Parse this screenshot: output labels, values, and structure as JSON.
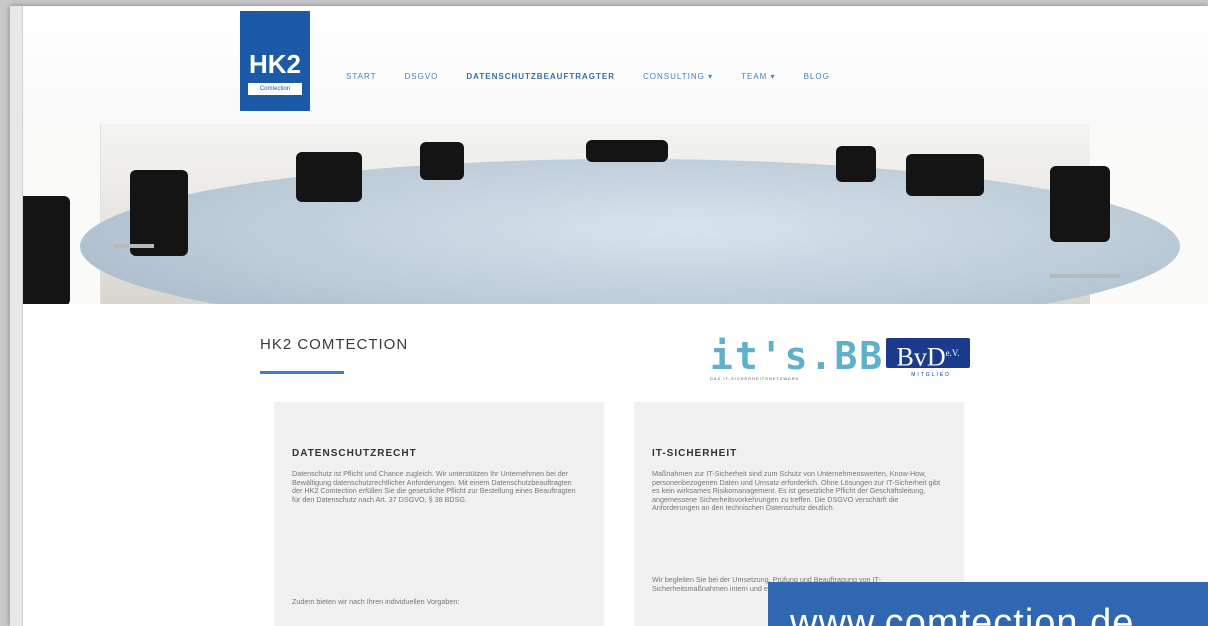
{
  "logo": {
    "text": "HK2",
    "sub": "Comtection"
  },
  "nav": [
    {
      "label": "START"
    },
    {
      "label": "DSGVO"
    },
    {
      "label": "DATENSCHUTZBEAUFTRAGTER"
    },
    {
      "label": "CONSULTING ▾"
    },
    {
      "label": "TEAM ▾"
    },
    {
      "label": "BLOG"
    }
  ],
  "section": {
    "title": "HK2 COMTECTION"
  },
  "badges": {
    "its": {
      "text": "it's.BB",
      "tag": "DAS IT-SICHERHEITSNETZWERK"
    },
    "bvd": {
      "text": "BvD",
      "sup": "e.V.",
      "sub": "MITGLIED"
    }
  },
  "cards": [
    {
      "title": "DATENSCHUTZRECHT",
      "body": "Datenschutz ist Pflicht und Chance zugleich. Wir unterstützen Ihr Unternehmen bei der Bewältigung datenschutzrechtlicher Anforderungen. Mit einem Datenschutzbeauftragten der HK2 Comtection erfüllen Sie die gesetzliche Pflicht zur Bestellung eines Beauftragten für den Datenschutz nach Art. 37 DSGVO, § 38 BDSG.",
      "body2": "Zudem bieten wir nach Ihren individuellen Vorgaben:"
    },
    {
      "title": "IT-SICHERHEIT",
      "body": "Maßnahmen zur IT-Sicherheit sind zum Schutz von Unternehmenswerten, Know-How, personenbezogenen Daten und Umsatz erforderlich. Ohne Lösungen zur IT-Sicherheit gibt es kein wirksames Risikomanagement. Es ist gesetzliche Pflicht der Geschäftsleitung, angemessene Sicherheitsvorkehrungen zu treffen. Die DSGVO verschärft die Anforderungen an den technischen Datenschutz deutlich.",
      "body2": "Wir begleiten Sie bei der Umsetzung, Prüfung und Beauftragung von IT-Sicherheitsmaßnahmen intern und extern."
    }
  ],
  "banner": {
    "url": "www.comtection.de"
  }
}
